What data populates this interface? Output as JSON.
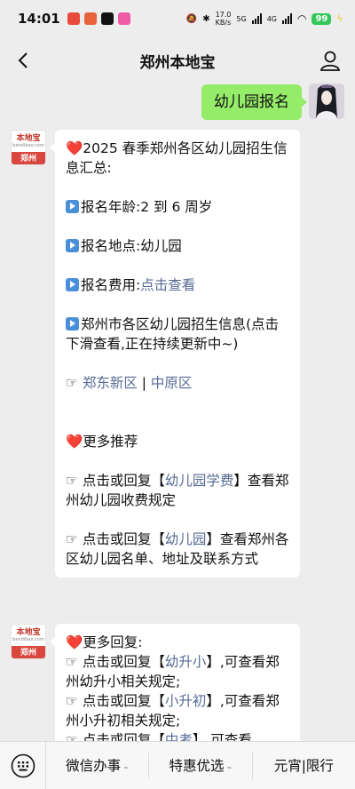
{
  "status_bar": {
    "time": "14:01",
    "net_speed": "17.0",
    "net_unit": "KB/s",
    "net_5g": "5G",
    "net_4g": "4G",
    "battery": "99"
  },
  "nav": {
    "title": "郑州本地宝"
  },
  "my_message": {
    "text": "幼儿园报名"
  },
  "bot_avatar": {
    "name": "本地宝",
    "url": "bendibao.com",
    "city": "郑州"
  },
  "message1": {
    "heading": "❤️2025 春季郑州各区幼儿园招生信息汇总:",
    "age_label": "报名年龄:2 到 6 周岁",
    "place_label": "报名地点:幼儿园",
    "fee_prefix": "报名费用:",
    "fee_link": "点击查看",
    "info_text": "郑州市各区幼儿园招生信息(点击下滑查看,正在持续更新中~)",
    "district_prefix": "☞ ",
    "district1": "郑东新区",
    "district_sep": " | ",
    "district2": "中原区",
    "more_title": "❤️更多推荐",
    "rec1_pre": "☞ 点击或回复【",
    "rec1_link": "幼儿园学费",
    "rec1_post": "】查看郑州幼儿园收费规定",
    "rec2_pre": "☞ 点击或回复【",
    "rec2_link": "幼儿园",
    "rec2_post": "】查看郑州各区幼儿园名单、地址及联系方式"
  },
  "message2": {
    "title": "❤️更多回复:",
    "r1_pre": "☞ 点击或回复【",
    "r1_link": "幼升小",
    "r1_post": "】,可查看郑州幼升小相关规定;",
    "r2_pre": "☞ 点击或回复【",
    "r2_link": "小升初",
    "r2_post": "】,可查看郑州小升初相关规定;",
    "r3_pre": "☞ 点击或回复【",
    "r3_link": "中考",
    "r3_post": "】,可查看"
  },
  "bottom_menu": {
    "item1": "微信办事",
    "item2": "特惠优选",
    "item3": "元宵|限行"
  }
}
